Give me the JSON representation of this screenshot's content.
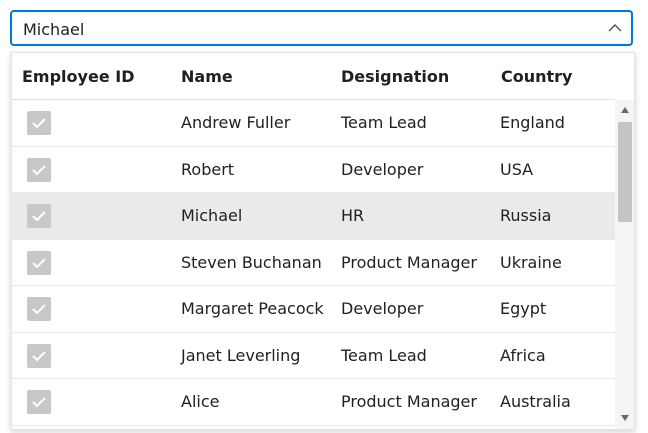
{
  "combo": {
    "value": "Michael",
    "icon": "chevron-up-icon"
  },
  "grid": {
    "columns": [
      "Employee ID",
      "Name",
      "Designation",
      "Country"
    ],
    "rows": [
      {
        "checked": true,
        "name": "Andrew Fuller",
        "designation": "Team Lead",
        "country": "England",
        "selected": false
      },
      {
        "checked": true,
        "name": "Robert",
        "designation": "Developer",
        "country": "USA",
        "selected": false
      },
      {
        "checked": true,
        "name": "Michael",
        "designation": "HR",
        "country": "Russia",
        "selected": true
      },
      {
        "checked": true,
        "name": "Steven Buchanan",
        "designation": "Product Manager",
        "country": "Ukraine",
        "selected": false
      },
      {
        "checked": true,
        "name": "Margaret Peacock",
        "designation": "Developer",
        "country": "Egypt",
        "selected": false
      },
      {
        "checked": true,
        "name": "Janet Leverling",
        "designation": "Team Lead",
        "country": "Africa",
        "selected": false
      },
      {
        "checked": true,
        "name": "Alice",
        "designation": "Product Manager",
        "country": "Australia",
        "selected": false
      }
    ]
  },
  "colors": {
    "accent": "#0078d4",
    "selected_row": "#eaeaea",
    "checkbox": "#c8c8c8"
  }
}
